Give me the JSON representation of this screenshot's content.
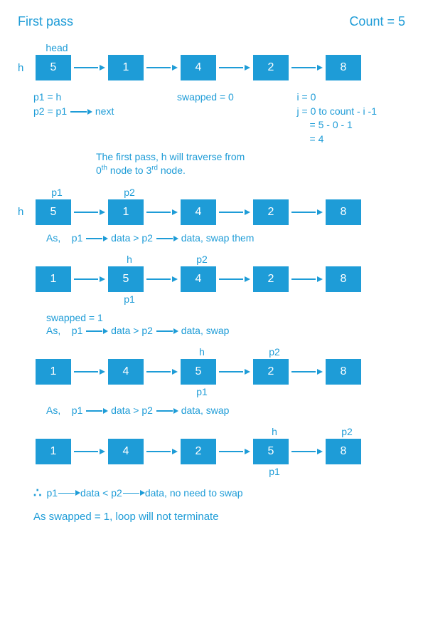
{
  "title": "First pass",
  "count_label": "Count = 5",
  "head_label": "head",
  "h_label": "h",
  "rows": [
    {
      "values": [
        "5",
        "1",
        "4",
        "2",
        "8"
      ],
      "top": [
        "head",
        "",
        "",
        "",
        ""
      ],
      "bot": [
        "",
        "",
        "",
        "",
        ""
      ],
      "h": true
    },
    {
      "values": [
        "5",
        "1",
        "4",
        "2",
        "8"
      ],
      "top": [
        "p1",
        "p2",
        "",
        "",
        ""
      ],
      "bot": [
        "",
        "",
        "",
        "",
        ""
      ],
      "h": true
    },
    {
      "values": [
        "1",
        "5",
        "4",
        "2",
        "8"
      ],
      "top": [
        "",
        "h",
        "p2",
        "",
        ""
      ],
      "bot": [
        "",
        "p1",
        "",
        "",
        ""
      ],
      "h": false
    },
    {
      "values": [
        "1",
        "4",
        "5",
        "2",
        "8"
      ],
      "top": [
        "",
        "",
        "h",
        "p2",
        ""
      ],
      "bot": [
        "",
        "",
        "p1",
        "",
        ""
      ],
      "h": false
    },
    {
      "values": [
        "1",
        "4",
        "2",
        "5",
        "8"
      ],
      "top": [
        "",
        "",
        "",
        "h",
        "p2"
      ],
      "bot": [
        "",
        "",
        "",
        "p1",
        ""
      ],
      "h": false
    }
  ],
  "annot": {
    "p1": "p1 = h",
    "p2": "p2 = p1",
    "next": "next",
    "swapped0": "swapped = 0",
    "i": "i = 0",
    "j1": "j = 0  to  count  - i -1",
    "j2": "= 5 - 0 - 1",
    "j3": "= 4"
  },
  "traverse1": "The first pass, h will traverse from",
  "traverse2_a": "0",
  "traverse2_sup1": "th",
  "traverse2_mid": " node to 3",
  "traverse2_sup2": "rd",
  "traverse2_end": " node.",
  "swap_line": {
    "as": "As,",
    "p1": "p1",
    "d1": "data > p2",
    "d2": "data,  swap them"
  },
  "swap_line2": {
    "as": "As,",
    "p1": "p1",
    "d1": "data > p2",
    "d2": "data,  swap"
  },
  "swapped1": "swapped  =  1",
  "noswap": {
    "p1": "p1",
    "d1": "data < p2",
    "d2": "data,  no need to swap"
  },
  "final": "As swapped  =  1,  loop will not terminate",
  "therefore": "∴"
}
